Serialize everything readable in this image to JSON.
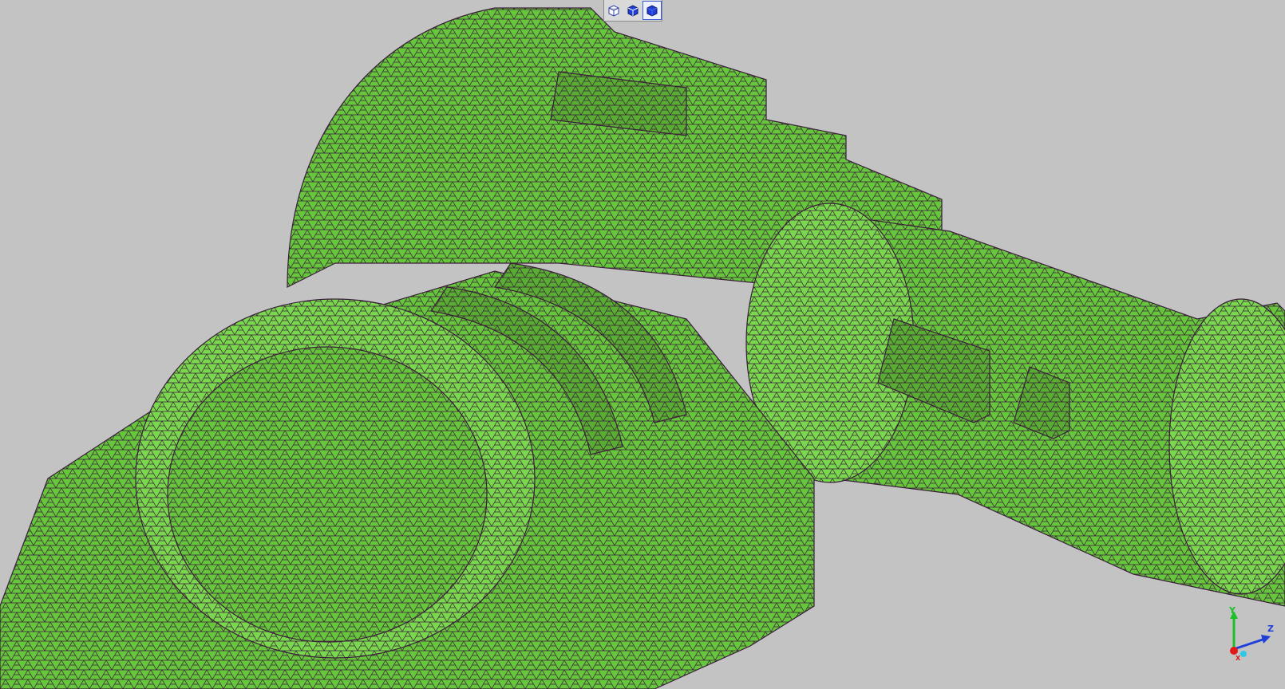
{
  "viewport": {
    "background_color": "#c3c3c3",
    "mesh_fill_color": "#66c63c",
    "mesh_shade_color": "#58ad32",
    "mesh_light_color": "#79d84d",
    "mesh_edge_color": "#3a1d3a"
  },
  "toolbar": {
    "buttons": [
      {
        "icon": "wireframe-cube-icon",
        "active": false
      },
      {
        "icon": "shaded-edges-cube-icon",
        "active": false
      },
      {
        "icon": "shaded-cube-icon",
        "active": true
      }
    ]
  },
  "triad": {
    "y_label": "Y",
    "z_label": "Z",
    "x_label": "X",
    "y_color": "#1fbf2a",
    "z_color": "#1f3fd8",
    "x_color": "#e01818"
  }
}
